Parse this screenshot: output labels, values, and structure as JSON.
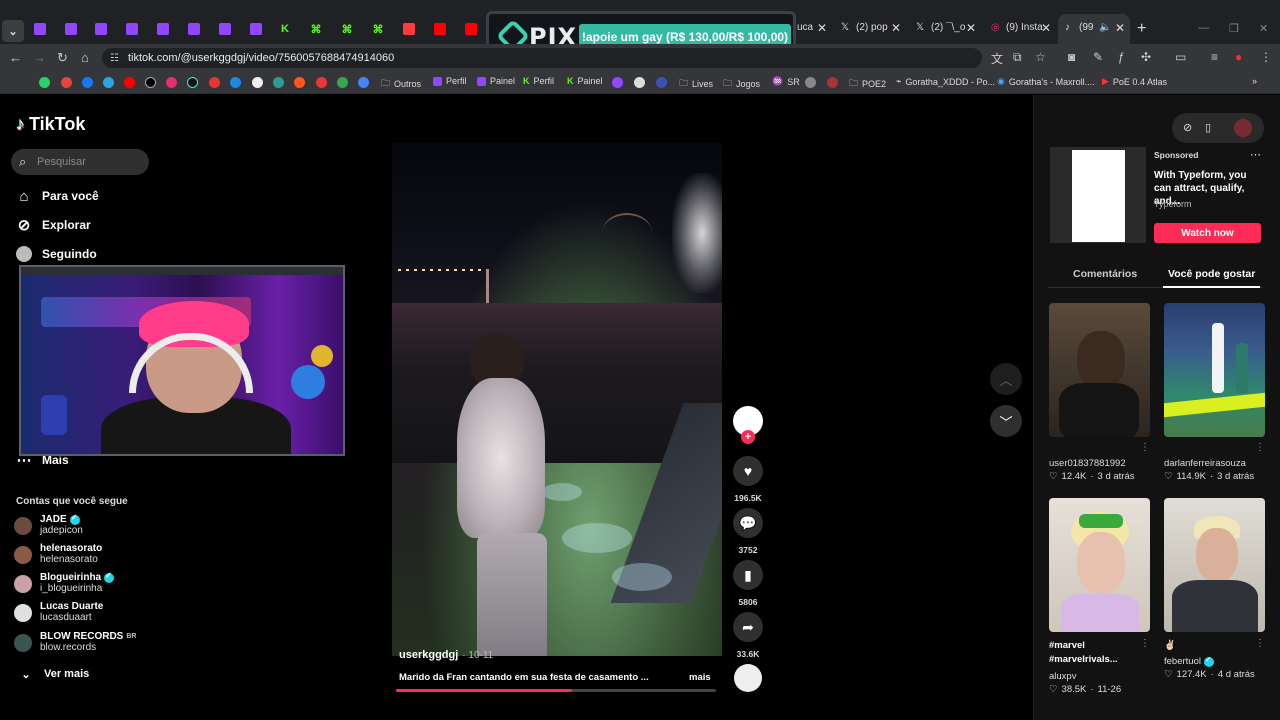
{
  "browser": {
    "url": "tiktok.com/@userkggdgj/video/7560057688474914060",
    "tabs": [
      {
        "label": "(2) pop",
        "icon": "x-logo-icon"
      },
      {
        "label": "(2) ¯\\_o",
        "icon": "x-logo-icon"
      },
      {
        "label": "(9) Insta",
        "icon": "instagram-icon"
      },
      {
        "label": "(99",
        "icon": "tiktok-icon"
      }
    ],
    "bookmarks": [
      {
        "label": "Outros",
        "icon": "folder-icon"
      },
      {
        "label": "Perfil",
        "icon": "twitch-icon"
      },
      {
        "label": "Painel",
        "icon": "twitch-icon"
      },
      {
        "label": "Perfil",
        "icon": "kick-icon"
      },
      {
        "label": "Painel",
        "icon": "kick-icon"
      },
      {
        "label": "Lives",
        "icon": "folder-icon"
      },
      {
        "label": "Jogos",
        "icon": "folder-icon"
      },
      {
        "label": "SR",
        "icon": "sr-icon"
      },
      {
        "label": "POE2",
        "icon": "folder-icon"
      },
      {
        "label": "Goratha_XDDD - Po...",
        "icon": "poe-icon"
      },
      {
        "label": "Goratha's - Maxroll....",
        "icon": "maxroll-icon"
      },
      {
        "label": "PoE 0.4 Atlas",
        "icon": "youtube-icon"
      }
    ]
  },
  "pix_banner": {
    "brand": "PIX",
    "message": "!apoie um gay (R$ 130,00/R$ 100,00)",
    "progress_fraction": 1.3
  },
  "tiktok": {
    "logo": "TikTok",
    "search_placeholder": "Pesquisar",
    "nav": [
      {
        "label": "Para você",
        "icon": "home-icon"
      },
      {
        "label": "Explorar",
        "icon": "compass-icon"
      },
      {
        "label": "Seguindo",
        "icon": "following-avatar-icon"
      },
      {
        "label": "Mais",
        "icon": "more-dots-icon"
      }
    ],
    "following_title": "Contas que você segue",
    "following": [
      {
        "name": "JADE",
        "handle": "jadepicon",
        "verified": true
      },
      {
        "name": "helenasorato",
        "handle": "helenasorato",
        "verified": false
      },
      {
        "name": "Blogueirinha",
        "handle": "i_blogueirinha",
        "verified": true
      },
      {
        "name": "Lucas Duarte",
        "handle": "lucasduaart",
        "verified": false
      },
      {
        "name": "BLOW RECORDS",
        "badge": "BR",
        "handle": "blow.records",
        "verified": false
      }
    ],
    "see_more": "Ver mais",
    "video": {
      "username": "userkggdgj",
      "date": "· 10-11",
      "caption": "Marido da Fran cantando em sua festa de casamento ...",
      "more_label": "mais",
      "progress_fraction": 0.55
    },
    "actions": {
      "likes": "196.5K",
      "comments": "3752",
      "saves": "5806",
      "shares": "33.6K"
    },
    "ad": {
      "label": "Sponsored",
      "title": "With Typeform, you can attract, qualify, and...",
      "brand": "Typeform",
      "cta": "Watch now"
    },
    "right_tabs": [
      "Comentários",
      "Você pode gostar"
    ],
    "suggestions": [
      {
        "user": "user01837881992",
        "likes": "12.4K",
        "age": "3 d atrás"
      },
      {
        "user": "darlanferreirasouza",
        "likes": "114.9K",
        "age": "3 d atrás"
      },
      {
        "title": "#marvel #marvelrivals...",
        "user": "aluxpv",
        "likes": "38.5K",
        "age": "11-26"
      },
      {
        "title": "✌🏻",
        "user": "febertuol",
        "likes": "127.4K",
        "age": "4 d atrás",
        "verified": true
      }
    ]
  }
}
